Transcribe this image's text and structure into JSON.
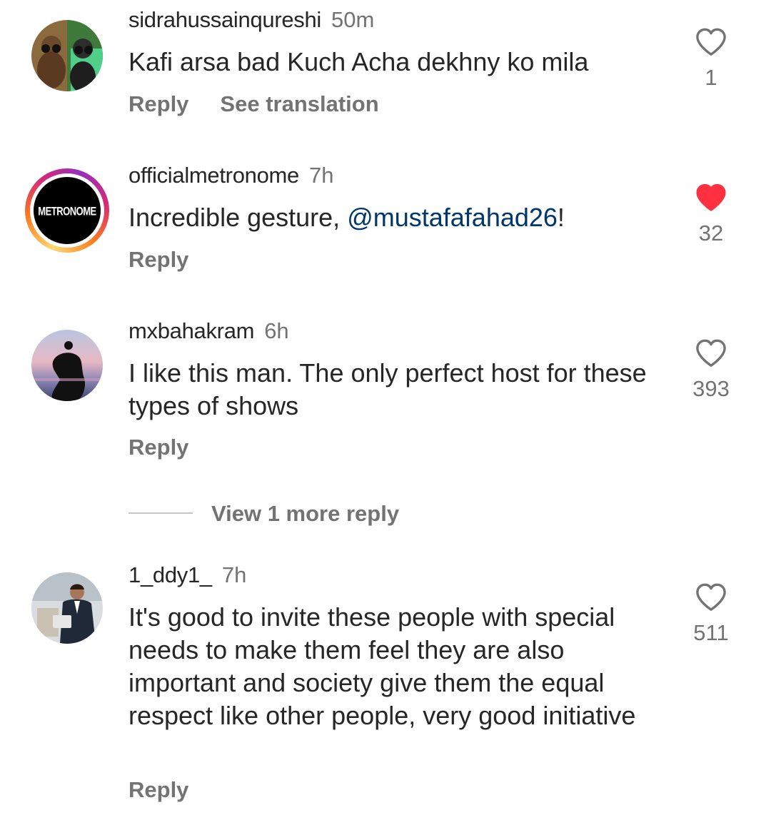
{
  "comments": [
    {
      "username": "sidrahussainqureshi",
      "time": "50m",
      "text": "Kafi arsa bad Kuch Acha dekhny ko mila",
      "reply_label": "Reply",
      "translate_label": "See translation",
      "likes": "1",
      "liked": false,
      "avatar_icon": "avatar-two-women-sunglasses"
    },
    {
      "username": "officialmetronome",
      "time": "7h",
      "text_before": "Incredible gesture, ",
      "mention": "@mustafafahad26",
      "text_after": "!",
      "reply_label": "Reply",
      "likes": "32",
      "liked": true,
      "avatar_label": "METRONOME"
    },
    {
      "username": "mxbahakram",
      "time": "6h",
      "text": "I like this man. The only perfect host for these types of shows",
      "reply_label": "Reply",
      "likes": "393",
      "liked": false,
      "avatar_icon": "avatar-silhouette-sunset"
    },
    {
      "username": "1_ddy1_",
      "time": "7h",
      "text": "It's good to invite these people with special needs to make them feel they are also important and society give them the equal respect like other people, very good initiative",
      "reply_label": "Reply",
      "likes": "511",
      "liked": false,
      "avatar_icon": "avatar-man-in-suit"
    }
  ],
  "view_more_label": "View 1 more reply",
  "colors": {
    "text": "#262626",
    "secondary": "#737373",
    "mention": "#00376b",
    "liked_heart": "#ff3040"
  }
}
